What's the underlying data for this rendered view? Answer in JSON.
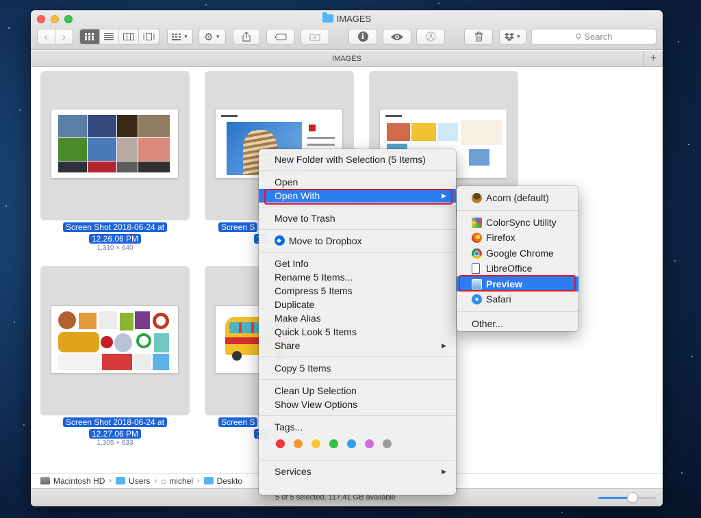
{
  "window": {
    "title": "IMAGES",
    "path_title": "IMAGES",
    "add_tab": "+"
  },
  "toolbar": {
    "back_icon": "‹",
    "forward_icon": "›",
    "search_placeholder": "Search",
    "search_icon": "⚲"
  },
  "files": [
    {
      "name_line1": "Screen Shot 2018-06-24 at",
      "name_line2": "12.26.06 PM",
      "dims": "1,310 × 640"
    },
    {
      "name_line1": "Screen S",
      "name_line2": "12"
    },
    {
      "name_line1": "",
      "name_line2": ""
    },
    {
      "name_line1": "Screen Shot 2018-06-24 at",
      "name_line2": "12.27.06 PM",
      "dims": "1,305 × 633"
    },
    {
      "name_line1": "Screen S",
      "name_line2": "12"
    }
  ],
  "context_menu": {
    "new_folder": "New Folder with Selection (5 Items)",
    "open": "Open",
    "open_with": "Open With",
    "move_to_trash": "Move to Trash",
    "move_to_dropbox": "Move to Dropbox",
    "get_info": "Get Info",
    "rename": "Rename 5 Items...",
    "compress": "Compress 5 Items",
    "duplicate": "Duplicate",
    "make_alias": "Make Alias",
    "quick_look": "Quick Look 5 Items",
    "share": "Share",
    "copy": "Copy 5 Items",
    "clean_up": "Clean Up Selection",
    "show_view_options": "Show View Options",
    "tags": "Tags...",
    "tag_colors": [
      "#f0353c",
      "#f7972d",
      "#f9c631",
      "#30c13f",
      "#29a1f0",
      "#d46ae0",
      "#9a9a9a"
    ],
    "services": "Services"
  },
  "open_with_menu": {
    "acorn": "Acorn (default)",
    "colorsync": "ColorSync Utility",
    "firefox": "Firefox",
    "chrome": "Google Chrome",
    "libreoffice": "LibreOffice",
    "preview": "Preview",
    "safari": "Safari",
    "other": "Other..."
  },
  "path_bar": {
    "items": [
      "Macintosh HD",
      "Users",
      "michel",
      "Deskto"
    ]
  },
  "status": {
    "text": "5 of 5 selected, 117.41 GB available",
    "zoom_level": 0.6
  }
}
